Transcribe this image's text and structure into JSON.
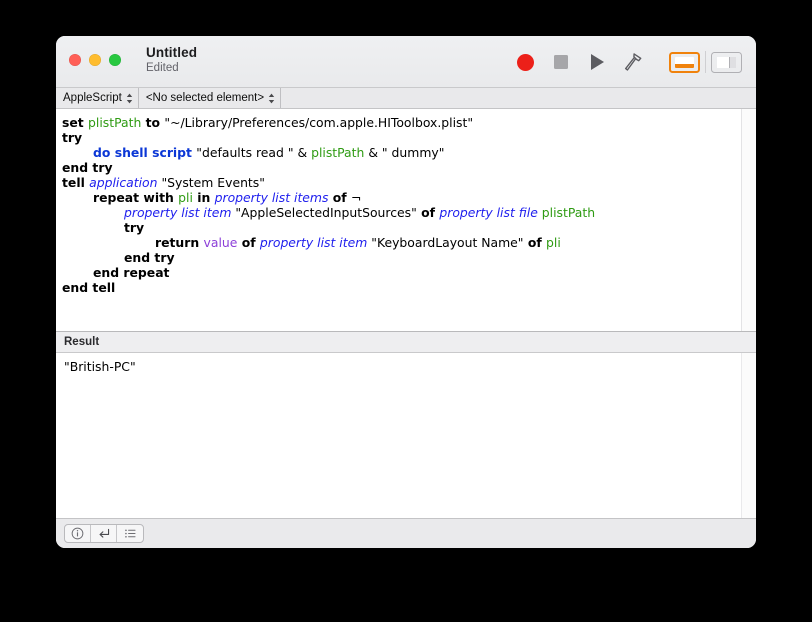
{
  "window": {
    "title": "Untitled",
    "subtitle": "Edited"
  },
  "traffic_lights": {
    "close": "close-button",
    "minimize": "minimize-button",
    "zoom": "zoom-button"
  },
  "toolbar": {
    "record_label": "Record",
    "stop_label": "Stop",
    "run_label": "Run",
    "compile_label": "Compile",
    "bottom_pane_toggle_label": "Show/Hide Log",
    "sidebar_toggle_label": "Show/Hide Navigator",
    "accent_color": "#f0820c",
    "record_color": "#ec2019"
  },
  "script_bar": {
    "language": "AppleScript",
    "element": "<No selected element>"
  },
  "editor": {
    "lines": [
      {
        "indent": 0,
        "tokens": [
          {
            "t": "set ",
            "c": "kw"
          },
          {
            "t": "plistPath",
            "c": "var"
          },
          {
            "t": " to ",
            "c": "kw"
          },
          {
            "t": "\"~/Library/Preferences/com.apple.HIToolbox.plist\"",
            "c": "str"
          }
        ]
      },
      {
        "indent": 0,
        "tokens": [
          {
            "t": "try",
            "c": "kw"
          }
        ]
      },
      {
        "indent": 2,
        "tokens": [
          {
            "t": "do shell script ",
            "c": "cmd"
          },
          {
            "t": "\"defaults read \"",
            "c": "str"
          },
          {
            "t": " & ",
            "c": "op"
          },
          {
            "t": "plistPath",
            "c": "var"
          },
          {
            "t": " & ",
            "c": "op"
          },
          {
            "t": "\" dummy\"",
            "c": "str"
          }
        ]
      },
      {
        "indent": 0,
        "tokens": [
          {
            "t": "end try",
            "c": "kw"
          }
        ]
      },
      {
        "indent": 0,
        "tokens": [
          {
            "t": "tell ",
            "c": "kw"
          },
          {
            "t": "application",
            "c": "cls"
          },
          {
            "t": " ",
            "c": "op"
          },
          {
            "t": "\"System Events\"",
            "c": "str"
          }
        ]
      },
      {
        "indent": 2,
        "tokens": [
          {
            "t": "repeat with ",
            "c": "kw"
          },
          {
            "t": "pli",
            "c": "var"
          },
          {
            "t": " in ",
            "c": "kw"
          },
          {
            "t": "property list items",
            "c": "cls"
          },
          {
            "t": " of ",
            "c": "kw"
          },
          {
            "t": "¬",
            "c": "op"
          }
        ]
      },
      {
        "indent": 4,
        "tokens": [
          {
            "t": "property list item",
            "c": "cls"
          },
          {
            "t": " ",
            "c": "op"
          },
          {
            "t": "\"AppleSelectedInputSources\"",
            "c": "str"
          },
          {
            "t": " of ",
            "c": "kw"
          },
          {
            "t": "property list file",
            "c": "cls"
          },
          {
            "t": " ",
            "c": "op"
          },
          {
            "t": "plistPath",
            "c": "var"
          }
        ]
      },
      {
        "indent": 4,
        "tokens": [
          {
            "t": "try",
            "c": "kw"
          }
        ]
      },
      {
        "indent": 6,
        "tokens": [
          {
            "t": "return ",
            "c": "kw"
          },
          {
            "t": "value",
            "c": "prop"
          },
          {
            "t": " of ",
            "c": "kw"
          },
          {
            "t": "property list item",
            "c": "cls"
          },
          {
            "t": " ",
            "c": "op"
          },
          {
            "t": "\"KeyboardLayout Name\"",
            "c": "str"
          },
          {
            "t": " of ",
            "c": "kw"
          },
          {
            "t": "pli",
            "c": "var"
          }
        ]
      },
      {
        "indent": 4,
        "tokens": [
          {
            "t": "end try",
            "c": "kw"
          }
        ]
      },
      {
        "indent": 2,
        "tokens": [
          {
            "t": "end repeat",
            "c": "kw"
          }
        ]
      },
      {
        "indent": 0,
        "tokens": [
          {
            "t": "end tell",
            "c": "kw"
          }
        ]
      }
    ],
    "syntax_colors": {
      "keyword": "#000000",
      "variable": "#2f9b13",
      "command": "#0b37d6",
      "class": "#2020ee",
      "property": "#8c3fd8",
      "string": "#000000"
    }
  },
  "result": {
    "header": "Result",
    "value": "\"British-PC\""
  },
  "bottom_bar": {
    "description_label": "Description",
    "result_label": "Result",
    "log_label": "Event Log"
  }
}
